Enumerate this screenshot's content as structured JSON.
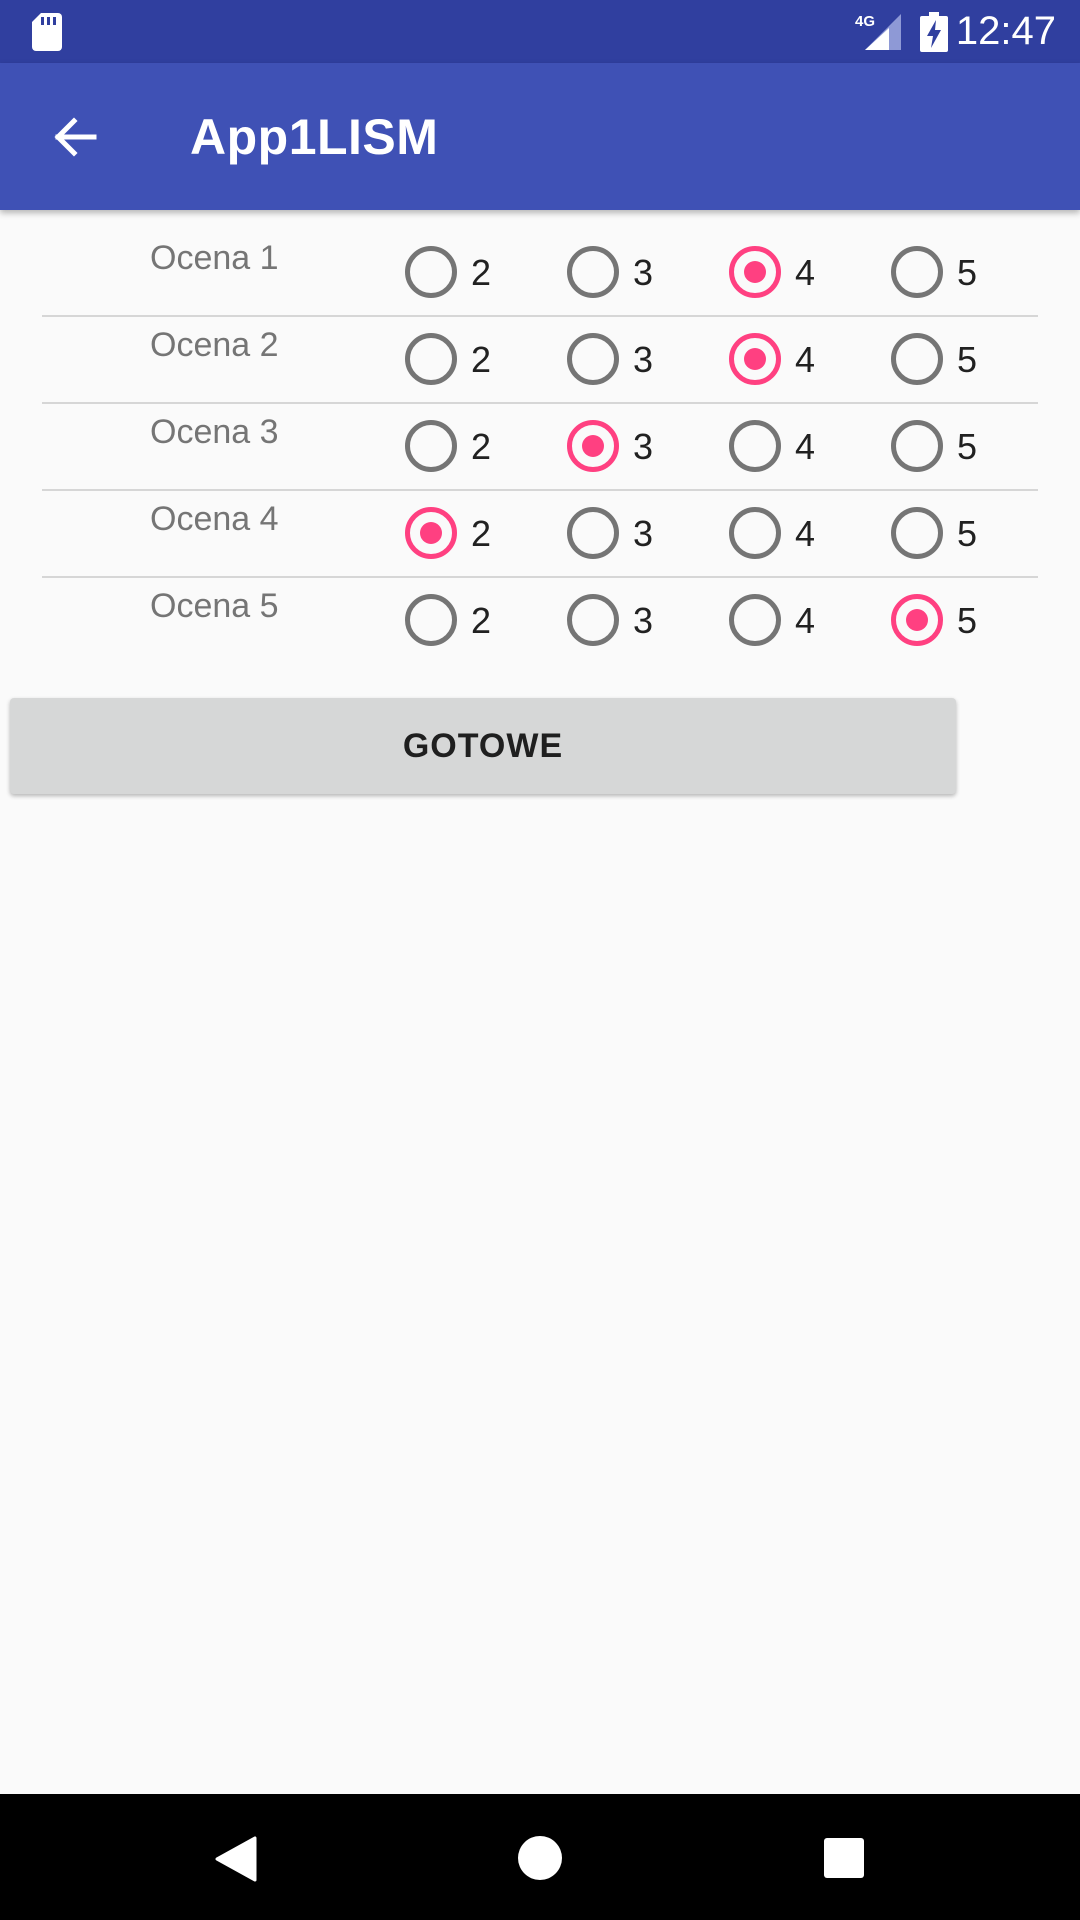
{
  "status_bar": {
    "network": "4G",
    "time": "12:47",
    "icons": [
      "sd-card-icon",
      "signal-icon",
      "battery-charging-icon"
    ]
  },
  "app_bar": {
    "title": "App1LISM",
    "back_icon": "arrow-back-icon"
  },
  "ratings": [
    {
      "label": "Ocena 1",
      "options": [
        "2",
        "3",
        "4",
        "5"
      ],
      "selected": "4"
    },
    {
      "label": "Ocena 2",
      "options": [
        "2",
        "3",
        "4",
        "5"
      ],
      "selected": "4"
    },
    {
      "label": "Ocena 3",
      "options": [
        "2",
        "3",
        "4",
        "5"
      ],
      "selected": "3"
    },
    {
      "label": "Ocena 4",
      "options": [
        "2",
        "3",
        "4",
        "5"
      ],
      "selected": "2"
    },
    {
      "label": "Ocena 5",
      "options": [
        "2",
        "3",
        "4",
        "5"
      ],
      "selected": "5"
    }
  ],
  "done_button": {
    "label": "GOTOWE"
  },
  "colors": {
    "status_bar": "#303f9f",
    "app_bar": "#3f51b5",
    "accent": "#ff4081",
    "radio_unchecked": "#757575",
    "button": "#d6d7d7"
  },
  "nav_bar": {
    "icons": [
      "nav-back-icon",
      "nav-home-icon",
      "nav-recents-icon"
    ]
  }
}
